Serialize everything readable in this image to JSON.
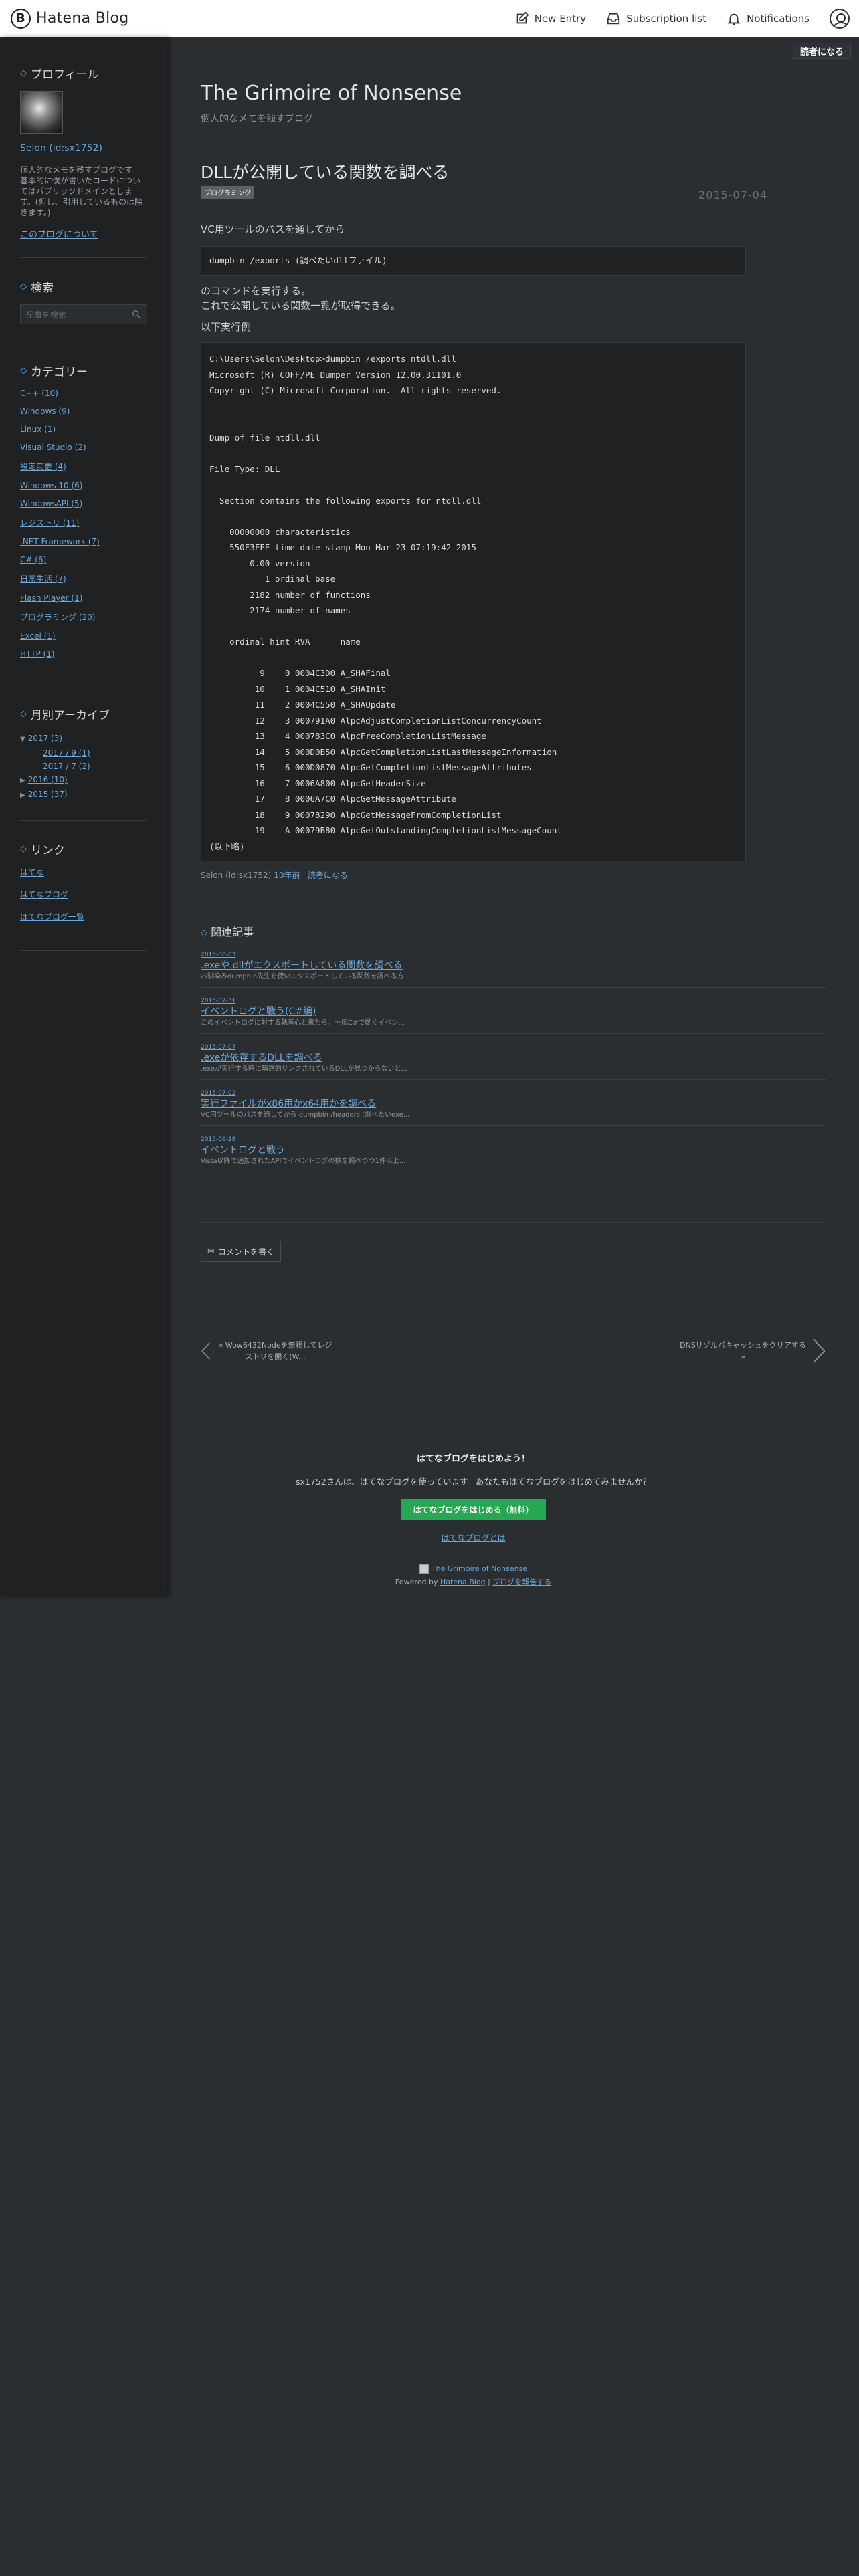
{
  "topbar": {
    "brand": "Hatena Blog",
    "new_entry": "New Entry",
    "subscription": "Subscription list",
    "notifications": "Notifications"
  },
  "reader_button": "読者になる",
  "sidebar": {
    "profile_title": "プロフィール",
    "profile_name": "Selon (id:sx1752)",
    "profile_desc": "個人的なメモを残すブログです。基本的に僕が書いたコードについてはパブリックドメインとします。(但し、引用しているものは除きます。)",
    "about": "このブログについて",
    "search_title": "検索",
    "search_placeholder": "記事を検索",
    "category_title": "カテゴリー",
    "categories": [
      "C++ (10)",
      "Windows (9)",
      "Linux (1)",
      "Visual Studio (2)",
      "設定変更 (4)",
      "Windows 10 (6)",
      "WindowsAPI (5)",
      "レジストリ (11)",
      ".NET Framework (7)",
      "C# (6)",
      "日常生活 (7)",
      "Flash Player (1)",
      "プログラミング (20)",
      "Excel (1)",
      "HTTP (1)"
    ],
    "archive_title": "月別アーカイブ",
    "archive": {
      "y2017": "2017 (3)",
      "m2017_9": "2017 / 9 (1)",
      "m2017_7": "2017 / 7 (2)",
      "y2016": "2016 (10)",
      "y2015": "2015 (37)"
    },
    "links_title": "リンク",
    "links": [
      "はてな",
      "はてなブログ",
      "はてなブログ一覧"
    ]
  },
  "main": {
    "blog_title": "The Grimoire of Nonsense",
    "blog_desc": "個人的なメモを残すブログ",
    "entry_title": "DLLが公開している関数を調べる",
    "category_badge": "プログラミング",
    "entry_date": "2015-07-04",
    "p1": "VC用ツールのパスを通してから",
    "code1": "dumpbin /exports (調べたいdllファイル)",
    "p2": "のコマンドを実行する。",
    "p3": "これで公開している関数一覧が取得できる。",
    "p4": "以下実行例",
    "code2": "C:\\Users\\Selon\\Desktop>dumpbin /exports ntdll.dll\nMicrosoft (R) COFF/PE Dumper Version 12.00.31101.0\nCopyright (C) Microsoft Corporation.  All rights reserved.\n\n\nDump of file ntdll.dll\n\nFile Type: DLL\n\n  Section contains the following exports for ntdll.dll\n\n    00000000 characteristics\n    550F3FFE time date stamp Mon Mar 23 07:19:42 2015\n        0.00 version\n           1 ordinal base\n        2182 number of functions\n        2174 number of names\n\n    ordinal hint RVA      name\n\n          9    0 0004C3D0 A_SHAFinal\n         10    1 0004C510 A_SHAInit\n         11    2 0004C550 A_SHAUpdate\n         12    3 000791A0 AlpcAdjustCompletionListConcurrencyCount\n         13    4 000783C0 AlpcFreeCompletionListMessage\n         14    5 000D0B50 AlpcGetCompletionListLastMessageInformation\n         15    6 000D0870 AlpcGetCompletionListMessageAttributes\n         16    7 0006A800 AlpcGetHeaderSize\n         17    8 0006A7C0 AlpcGetMessageAttribute\n         18    9 00078290 AlpcGetMessageFromCompletionList\n         19    A 00079B80 AlpcGetOutstandingCompletionListMessageCount\n(以下略)",
    "author_line": "Selon (id:sx1752)",
    "time_ago": "10年前",
    "reader_link": "読者になる"
  },
  "related": {
    "title": "関連記事",
    "items": [
      {
        "date": "2015-08-03",
        "title": ".exeや.dllがエクスポートしている関数を調べる",
        "summary": "お馴染みdumpbin先生を使いエクスポートしている関数を調べる方..."
      },
      {
        "date": "2015-07-31",
        "title": "イベントログと戦う(C#編)",
        "summary": "このイベントログに対する執着心と来たら。一応C#で動くイベン..."
      },
      {
        "date": "2015-07-07",
        "title": ".exeが依存するDLLを調べる",
        "summary": ".exeが実行する時に暗黙的リンクされているDLLが見つからないと..."
      },
      {
        "date": "2015-07-02",
        "title": "実行ファイルがx86用かx64用かを調べる",
        "summary": "VC用ツールのパスを通してから dumpbin /headers (調べたいexe..."
      },
      {
        "date": "2015-06-28",
        "title": "イベントログと戦う",
        "summary": "Vista以降で追加されたAPIでイベントログの数を調べつつ1件以上..."
      }
    ]
  },
  "comment_button": "コメントを書く",
  "pager": {
    "prev": "« Wow6432Nodeを無視してレジストリを開く(W...",
    "next": "DNSリゾルバキャッシュをクリアする »"
  },
  "promo": {
    "title": "はてなブログをはじめよう！",
    "text": "sx1752さんは、はてなブログを使っています。あなたもはてなブログをはじめてみませんか？",
    "button": "はてなブログをはじめる（無料）",
    "about": "はてなブログとは"
  },
  "footer": {
    "blog_link": "The Grimoire of Nonsense",
    "powered": "Powered by",
    "hatena": "Hatena Blog",
    "sep": "|",
    "report": "ブログを報告する"
  }
}
